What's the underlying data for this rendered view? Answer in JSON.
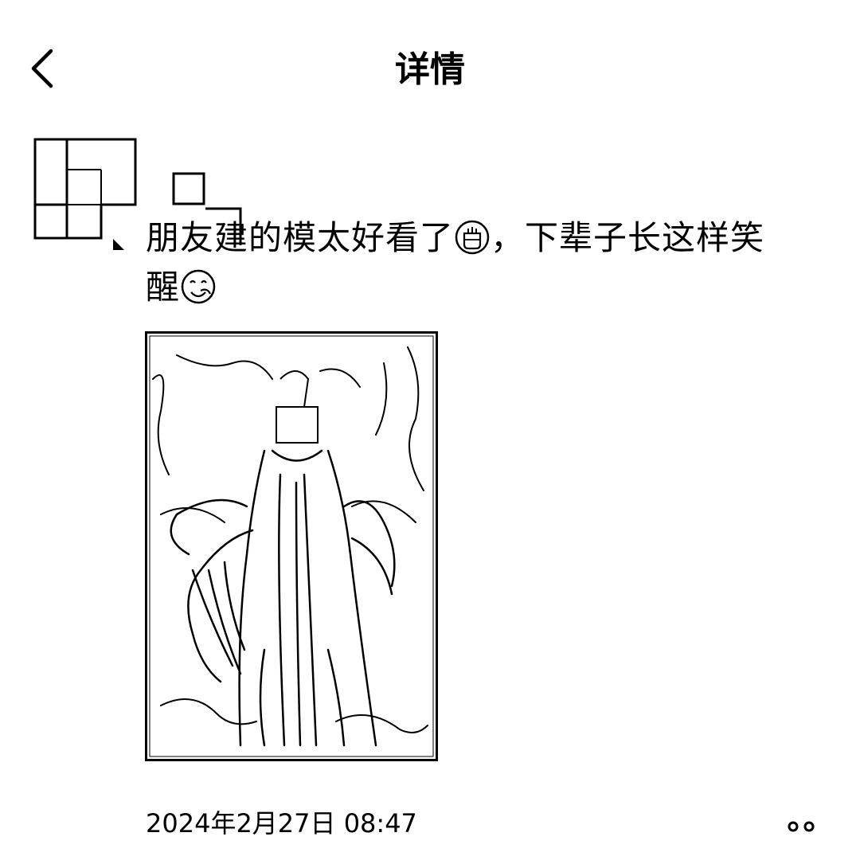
{
  "header": {
    "title": "详情",
    "back_icon": "chevron-left-icon"
  },
  "post": {
    "text_line1": "朋友建的模太好看了",
    "emoji1": "raised-fist-emoji",
    "text_line1b": "，下辈子长这样笑",
    "text_line2": "醒",
    "emoji2": "face-with-hand-over-mouth-emoji",
    "timestamp": "2024年2月27日 08:47"
  },
  "actions": {
    "more_icon": "more-dots-icon"
  }
}
